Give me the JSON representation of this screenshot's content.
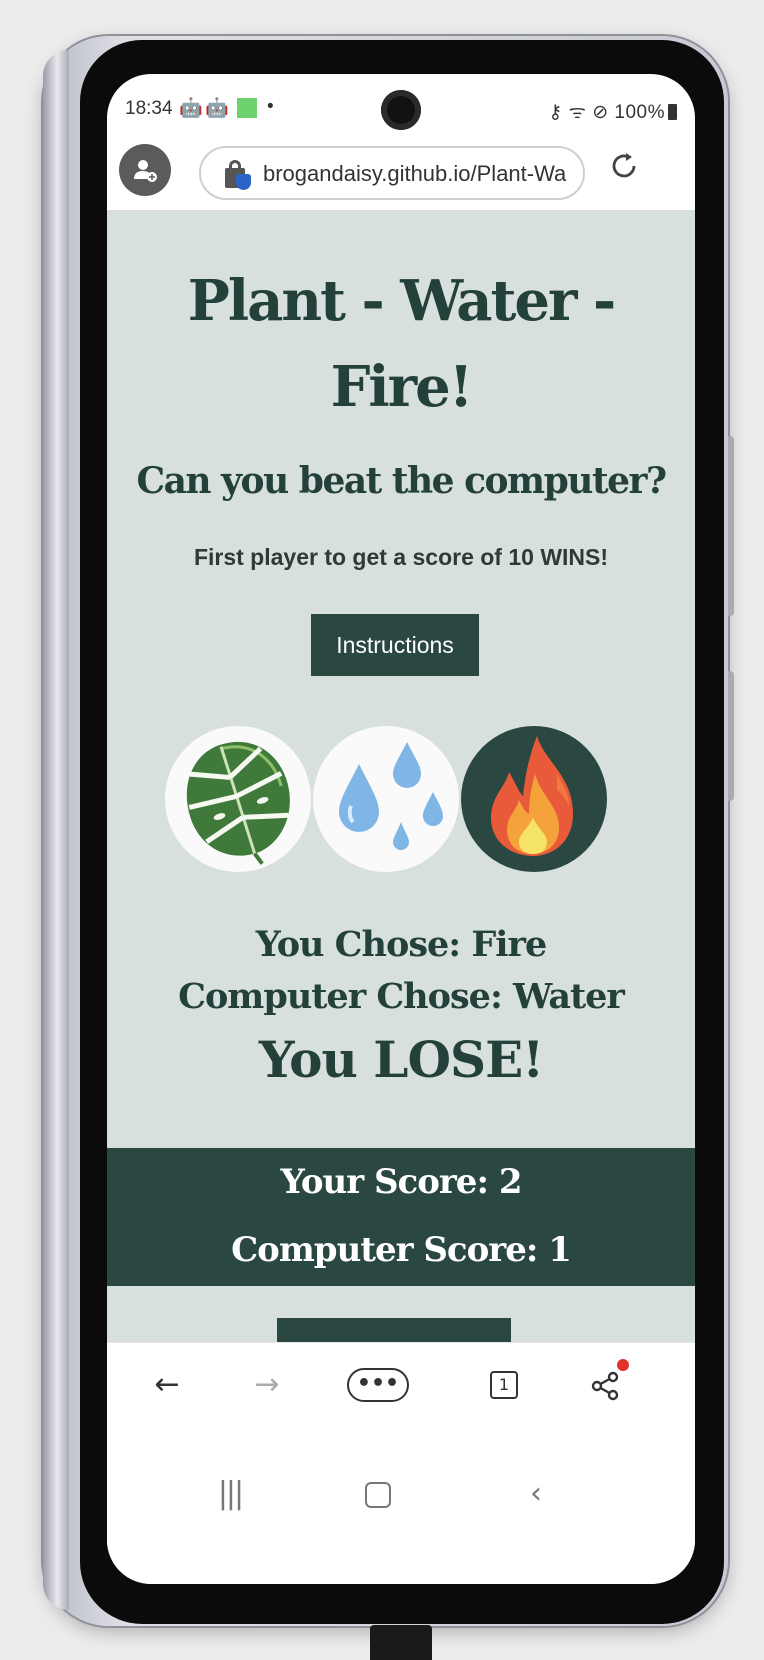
{
  "status_bar": {
    "time": "18:34",
    "notification_icons": [
      "android-icon",
      "android-icon",
      "green-square-icon",
      "dot-icon"
    ],
    "right_indicators": "⚷ ᯤ ⊘ 100%",
    "battery": "100%"
  },
  "browser": {
    "url": "brogandaisy.github.io/Plant-Water-Fire",
    "url_visible": "brogandaisy.github.io/Plant-Wa",
    "icons": {
      "profile": "profile-icon",
      "lock": "secure-lock-icon",
      "reload": "reload-icon"
    }
  },
  "page": {
    "title_line1": "Plant - Water -",
    "title_line2": "Fire!",
    "subtitle": "Can you beat the computer?",
    "description": "First player to get a score of 10 WINS!",
    "instructions_button": "Instructions",
    "choices": [
      {
        "name": "plant",
        "icon": "monstera-leaf-icon"
      },
      {
        "name": "water",
        "icon": "water-drops-icon"
      },
      {
        "name": "fire",
        "icon": "flame-icon"
      }
    ],
    "result": {
      "you_chose": "You Chose: Fire",
      "computer_chose": "Computer Chose: Water",
      "outcome": "You LOSE!"
    },
    "scores": {
      "your_score": "Your Score: 2",
      "computer_score": "Computer Score: 1"
    },
    "colors": {
      "background": "#d7e0dc",
      "accent": "#2b4742",
      "text": "#24403a"
    }
  },
  "toolbar": {
    "back": "←",
    "forward": "→",
    "menu": "•••",
    "tabs_count": "1",
    "share": "share-icon"
  },
  "navbar": {
    "recent": "|||",
    "home": "home-icon",
    "back": "‹"
  }
}
